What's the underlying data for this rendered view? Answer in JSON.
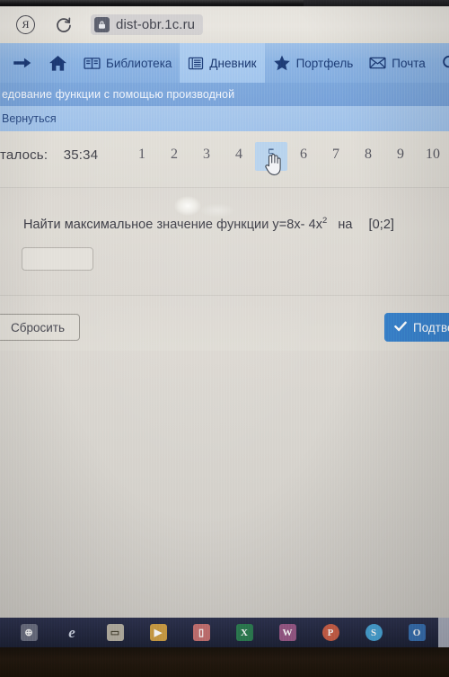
{
  "browser": {
    "yandex_logo": "Я",
    "reload_icon": "reload-icon",
    "lock_icon": "lock-icon",
    "url": "dist-obr.1c.ru"
  },
  "site_nav": {
    "forward_icon": "arrow-right-icon",
    "home_icon": "home-icon",
    "items": [
      {
        "label": "Библиотека",
        "icon": "book-icon",
        "active": false
      },
      {
        "label": "Дневник",
        "icon": "notebook-icon",
        "active": true
      },
      {
        "label": "Портфель",
        "icon": "star-icon",
        "active": false
      },
      {
        "label": "Почта",
        "icon": "envelope-icon",
        "active": false
      }
    ],
    "search_icon": "search-icon"
  },
  "header": {
    "test_title": "едование функции с помощью производной",
    "back_link": "Вернуться"
  },
  "quiz": {
    "timer_label": "талось:",
    "timer_value": "35:34",
    "pages": [
      "1",
      "2",
      "3",
      "4",
      "5",
      "6",
      "7",
      "8",
      "9",
      "10"
    ],
    "current_page": "5",
    "cursor_icon": "hand-cursor-icon"
  },
  "question": {
    "prefix": "Найти максимальное значение функции y=8x- 4x",
    "exponent": "2",
    "on_word": "на",
    "interval": "[0;2]",
    "answer_value": "",
    "answer_placeholder": ""
  },
  "footer": {
    "reset_label": "Сбросить",
    "confirm_label": "Подтвердить",
    "confirm_check_icon": "check-icon",
    "confirm_color": "#3a84cd"
  },
  "taskbar": {
    "items": [
      {
        "name": "start-button",
        "glyph": "⊕",
        "color": "#8b8f9e",
        "active": false
      },
      {
        "name": "internet-explorer",
        "glyph": "e",
        "color": "#2f4f7d",
        "active": false
      },
      {
        "name": "file-explorer",
        "glyph": "▭",
        "color": "#c9b577",
        "active": false
      },
      {
        "name": "media-player",
        "glyph": "▶",
        "color": "#d7a23c",
        "active": false
      },
      {
        "name": "pdf-reader",
        "glyph": "▯",
        "color": "#c25050",
        "active": false
      },
      {
        "name": "excel",
        "glyph": "X",
        "color": "#1d7044",
        "active": false
      },
      {
        "name": "word",
        "glyph": "W",
        "color": "#8d4a7e",
        "active": false
      },
      {
        "name": "powerpoint",
        "glyph": "P",
        "color": "#c65030",
        "active": false
      },
      {
        "name": "skype",
        "glyph": "S",
        "color": "#3aa0d8",
        "active": false
      },
      {
        "name": "outlook",
        "glyph": "O",
        "color": "#2a6bb0",
        "active": false
      },
      {
        "name": "active-window",
        "glyph": "∨",
        "color": "#6e7a8c",
        "active": true
      }
    ]
  }
}
